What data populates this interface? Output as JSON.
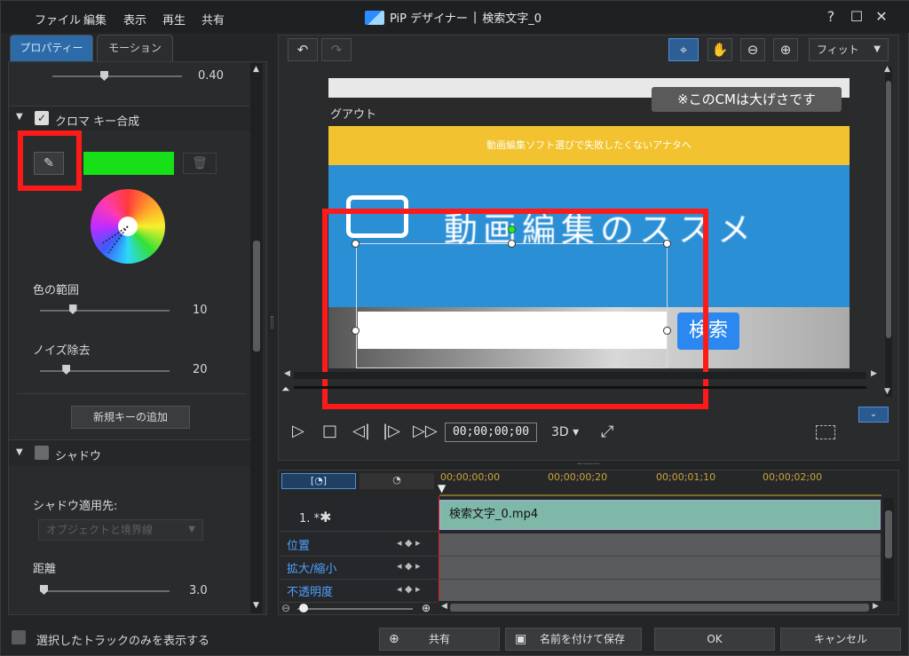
{
  "menu": [
    "ファイル",
    "編集",
    "表示",
    "再生",
    "共有"
  ],
  "window": {
    "title": "PiP デザイナー",
    "separator": "|",
    "doc": "検索文字_0",
    "help": "?",
    "maximize": "☐",
    "close": "✕"
  },
  "tabs": {
    "properties": "プロパティー",
    "motion": "モーション"
  },
  "panel": {
    "top_value": "0.40",
    "chroma": {
      "title": "クロマ キー合成",
      "checked": true,
      "key_color": "#18e018",
      "range_label": "色の範囲",
      "range_value": "10",
      "range_fraction": 0.25,
      "noise_label": "ノイズ除去",
      "noise_value": "20",
      "noise_fraction": 0.2,
      "add_key": "新規キーの追加"
    },
    "shadow": {
      "title": "シャドウ",
      "checked": false,
      "apply_label": "シャドウ適用先:",
      "apply_value": "オブジェクトと境界線",
      "distance_label": "距離",
      "distance_value": "3.0"
    }
  },
  "preview": {
    "fit_label": "フィット",
    "overlay_caption": "※このCMは大げさです",
    "logout_text": "グアウト",
    "banner_text": "動画編集ソフト選びで失敗したくないアナタへ",
    "site_title": "動画編集のススメ",
    "search_button": "検索",
    "timecode": "00;00;00;00",
    "mode_3d": "3D"
  },
  "timeline": {
    "ruler": [
      "00;00;00;00",
      "00;00;00;20",
      "00;00;01;10",
      "00;00;02;00"
    ],
    "track_name": "1. *",
    "clip_name": "検索文字_0.mp4",
    "props": [
      "位置",
      "拡大/縮小",
      "不透明度"
    ]
  },
  "footer": {
    "only_selected": "選択したトラックのみを表示する",
    "share": "共有",
    "save_as": "名前を付けて保存",
    "ok": "OK",
    "cancel": "キャンセル"
  },
  "colors": {
    "accent": "#2d6ba8",
    "highlight_red": "#ff1a1a",
    "clip": "#7fb7a8",
    "timeline_blue": "#4ea1ff"
  }
}
